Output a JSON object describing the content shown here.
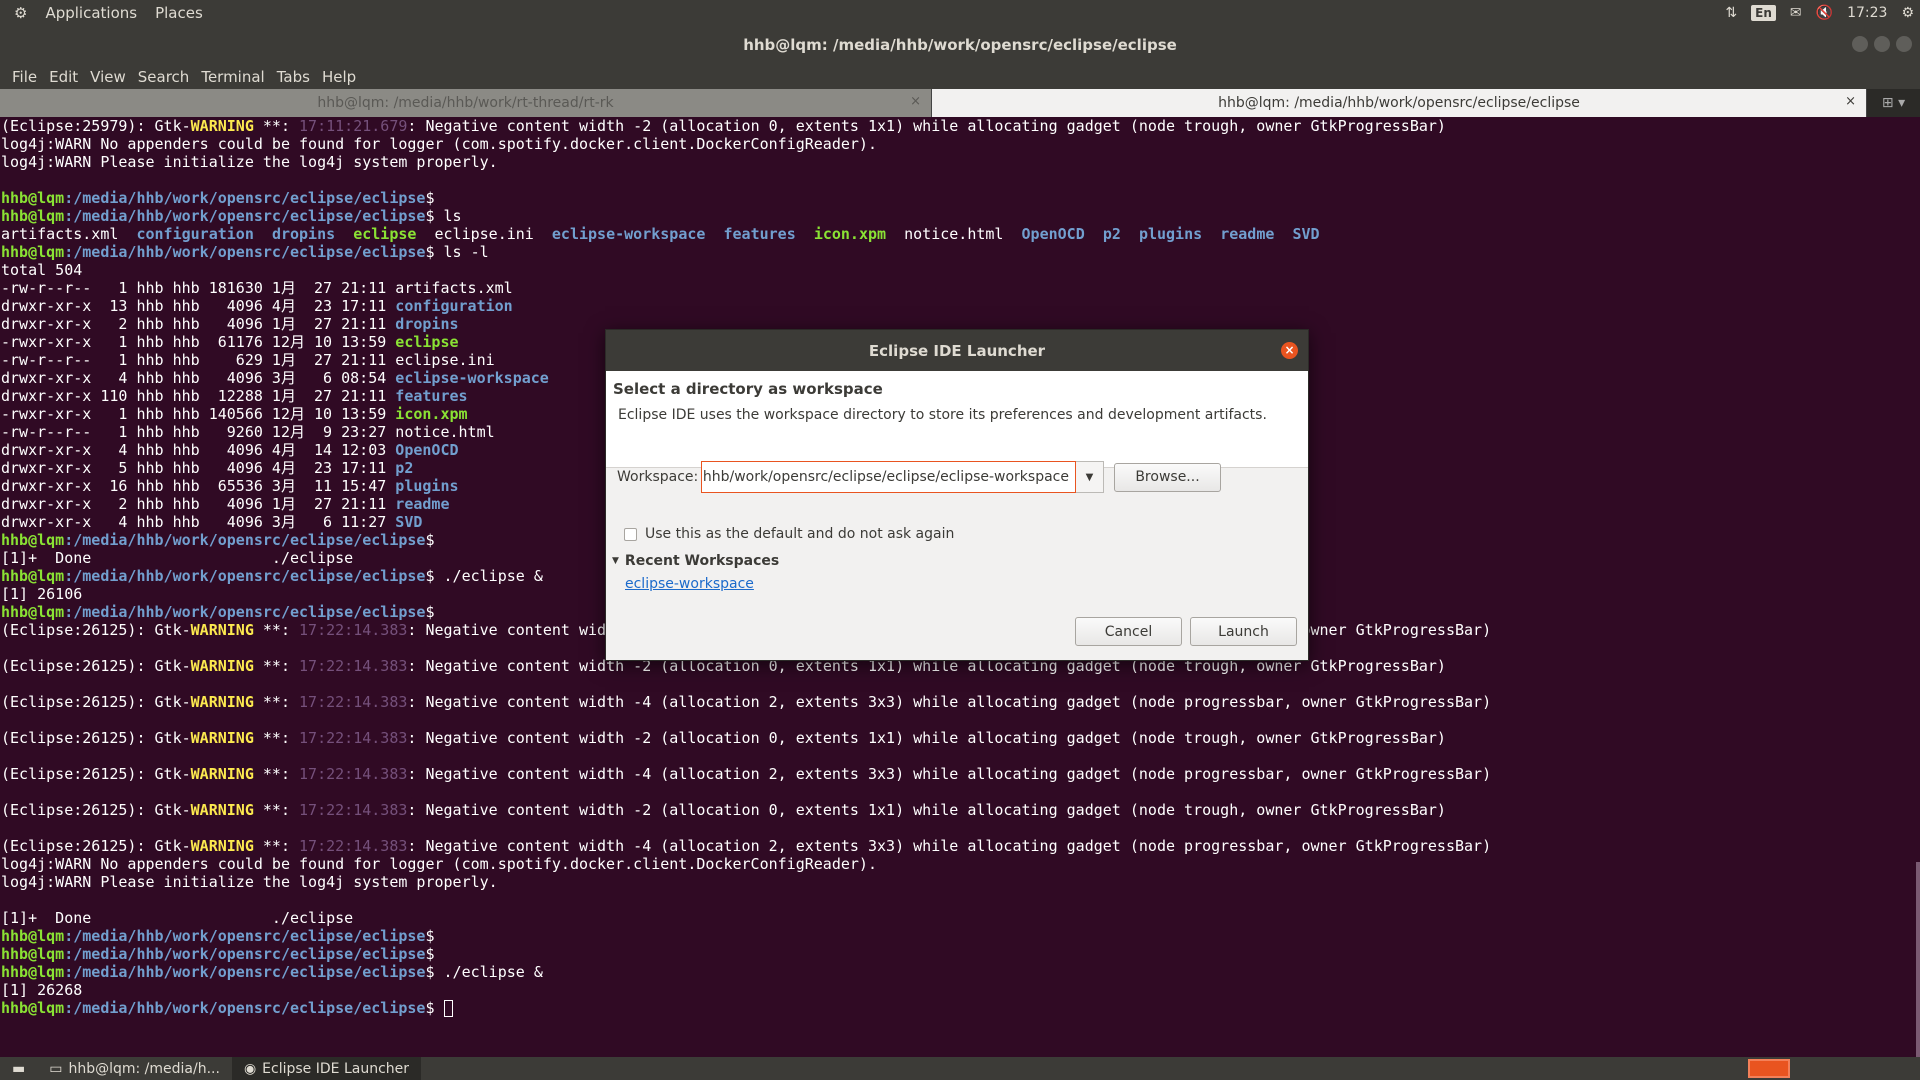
{
  "top_panel": {
    "menus": [
      "Applications",
      "Places"
    ],
    "lang": "En",
    "clock": "17:23"
  },
  "window": {
    "title": "hhb@lqm: /media/hhb/work/opensrc/eclipse/eclipse"
  },
  "menubar": [
    "File",
    "Edit",
    "View",
    "Search",
    "Terminal",
    "Tabs",
    "Help"
  ],
  "tabs": [
    {
      "label": "hhb@lqm: /media/hhb/work/rt-thread/rt-rk"
    },
    {
      "label": "hhb@lqm: /media/hhb/work/opensrc/eclipse/eclipse"
    }
  ],
  "terminal": {
    "prompt_user": "hhb@lqm",
    "prompt_path": ":/media/hhb/work/opensrc/eclipse/eclipse",
    "warn_prefix_1": "(Eclipse:25979): Gtk-",
    "warn_word": "WARNING",
    "warn_stars": " **: ",
    "time_1": "17:11:21.679",
    "warn_msg_trough": ": Negative content width -2 (allocation 0, extents 1x1) while allocating gadget (node trough, owner GtkProgressBar)",
    "warn_msg_pbar": ": Negative content width -4 (allocation 2, extents 3x3) while allocating gadget (node progressbar, owner GtkProgressBar)",
    "log1": "log4j:WARN No appenders could be found for logger (com.spotify.docker.client.DockerConfigReader).",
    "log2": "log4j:WARN Please initialize the log4j system properly.",
    "cmd_ls": "$ ls",
    "cmd_lsl": "$ ls -l",
    "ls_files": {
      "f1": "artifacts.xml",
      "d1": "configuration",
      "d2": "dropins",
      "x1": "eclipse",
      "f2": "eclipse.ini",
      "d3": "eclipse-workspace",
      "d4": "features",
      "x2": "icon.xpm",
      "f3": "notice.html",
      "d5": "OpenOCD",
      "d6": "p2",
      "d7": "plugins",
      "d8": "readme",
      "d9": "SVD"
    },
    "total": "total 504",
    "lsl": [
      {
        "perm": "-rw-r--r--   1 hhb hhb 181630 1月  27 21:11 ",
        "name": "artifacts.xml",
        "cls": ""
      },
      {
        "perm": "drwxr-xr-x  13 hhb hhb   4096 4月  23 17:11 ",
        "name": "configuration",
        "cls": "b"
      },
      {
        "perm": "drwxr-xr-x   2 hhb hhb   4096 1月  27 21:11 ",
        "name": "dropins",
        "cls": "b"
      },
      {
        "perm": "-rwxr-xr-x   1 hhb hhb  61176 12月 10 13:59 ",
        "name": "eclipse",
        "cls": "g"
      },
      {
        "perm": "-rw-r--r--   1 hhb hhb    629 1月  27 21:11 ",
        "name": "eclipse.ini",
        "cls": ""
      },
      {
        "perm": "drwxr-xr-x   4 hhb hhb   4096 3月   6 08:54 ",
        "name": "eclipse-workspace",
        "cls": "b"
      },
      {
        "perm": "drwxr-xr-x 110 hhb hhb  12288 1月  27 21:11 ",
        "name": "features",
        "cls": "b"
      },
      {
        "perm": "-rwxr-xr-x   1 hhb hhb 140566 12月 10 13:59 ",
        "name": "icon.xpm",
        "cls": "g"
      },
      {
        "perm": "-rw-r--r--   1 hhb hhb   9260 12月  9 23:27 ",
        "name": "notice.html",
        "cls": ""
      },
      {
        "perm": "drwxr-xr-x   4 hhb hhb   4096 4月  14 12:03 ",
        "name": "OpenOCD",
        "cls": "b"
      },
      {
        "perm": "drwxr-xr-x   5 hhb hhb   4096 4月  23 17:11 ",
        "name": "p2",
        "cls": "b"
      },
      {
        "perm": "drwxr-xr-x  16 hhb hhb  65536 3月  11 15:47 ",
        "name": "plugins",
        "cls": "b"
      },
      {
        "perm": "drwxr-xr-x   2 hhb hhb   4096 1月  27 21:11 ",
        "name": "readme",
        "cls": "b"
      },
      {
        "perm": "drwxr-xr-x   4 hhb hhb   4096 3月   6 11:27 ",
        "name": "SVD",
        "cls": "b"
      }
    ],
    "done": "[1]+  Done                    ./eclipse",
    "cmd_launch": "$ ./eclipse &",
    "job1": "[1] 26106",
    "warn_prefix_2": "(Eclipse:26125): Gtk-",
    "time_2": "17:22:14.383",
    "job2": "[1] 26268",
    "dollar": "$ "
  },
  "dialog": {
    "title": "Eclipse IDE Launcher",
    "heading": "Select a directory as workspace",
    "description": "Eclipse IDE uses the workspace directory to store its preferences and development artifacts.",
    "workspace_label": "Workspace:",
    "workspace_value": "hhb/work/opensrc/eclipse/eclipse/eclipse-workspace",
    "browse": "Browse...",
    "default_checkbox": "Use this as the default and do not ask again",
    "recent_header": "Recent Workspaces",
    "recent_link": "eclipse-workspace",
    "cancel": "Cancel",
    "launch": "Launch"
  },
  "taskbar": [
    {
      "label": "hhb@lqm: /media/h..."
    },
    {
      "label": "Eclipse IDE Launcher"
    }
  ]
}
